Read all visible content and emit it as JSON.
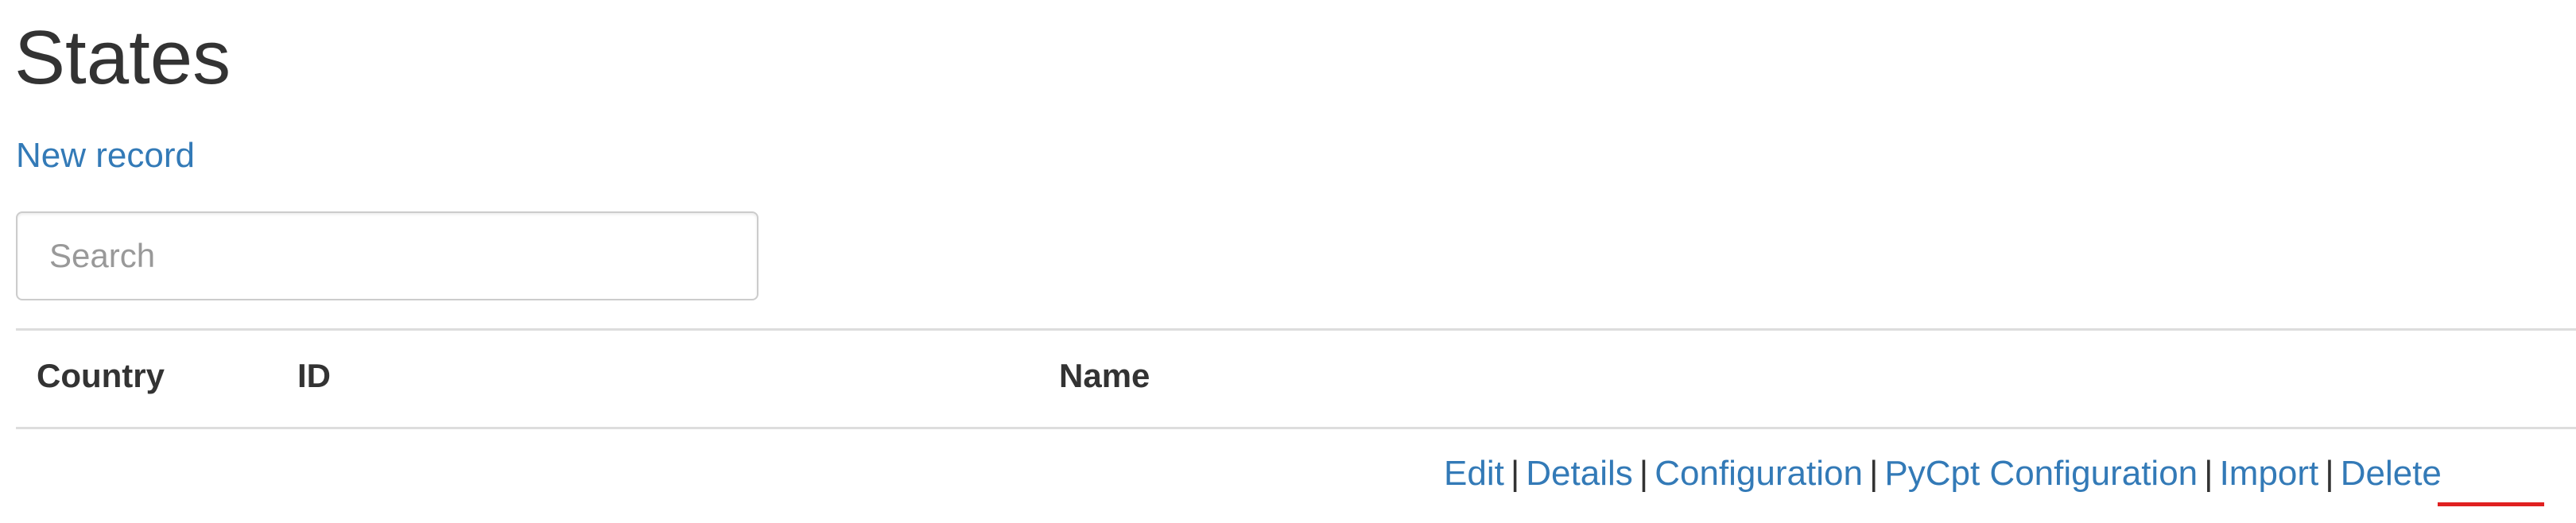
{
  "page": {
    "title": "States"
  },
  "toolbar": {
    "new_record_label": "New record"
  },
  "search": {
    "placeholder": "Search",
    "value": ""
  },
  "table": {
    "columns": [
      "Country",
      "ID",
      "Name"
    ]
  },
  "row_actions": {
    "edit": "Edit",
    "details": "Details",
    "configuration": "Configuration",
    "pycpt_configuration": "PyCpt Configuration",
    "import": "Import",
    "delete": "Delete",
    "separator": "|"
  },
  "colors": {
    "link": "#337ab7",
    "text": "#333333",
    "highlight_underline": "#e02020"
  }
}
